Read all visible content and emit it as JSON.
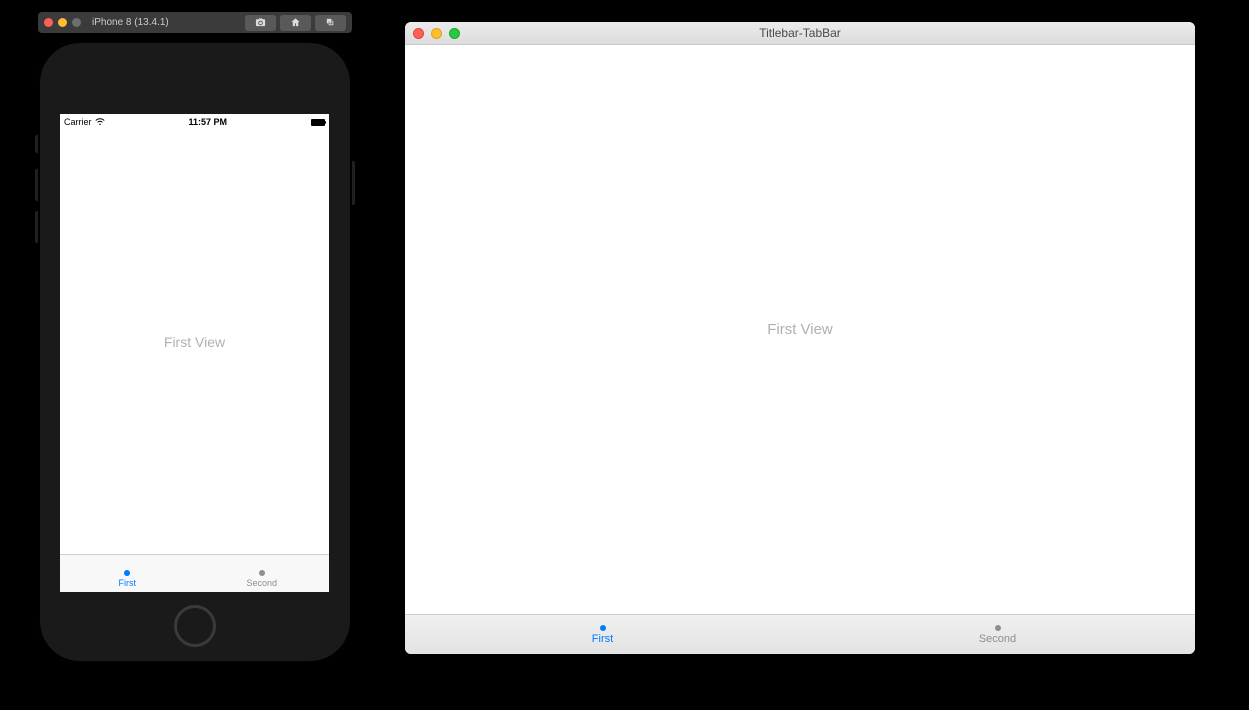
{
  "simulator": {
    "device_label": "iPhone 8 (13.4.1)",
    "buttons": {
      "screenshot": "camera-icon",
      "home": "home-icon",
      "rotate": "stack-icon"
    }
  },
  "iphone": {
    "status": {
      "carrier": "Carrier",
      "time": "11:57 PM"
    },
    "content_label": "First View",
    "tabs": [
      {
        "label": "First",
        "active": true
      },
      {
        "label": "Second",
        "active": false
      }
    ]
  },
  "mac": {
    "window_title": "Titlebar-TabBar",
    "content_label": "First View",
    "tabs": [
      {
        "label": "First",
        "active": true
      },
      {
        "label": "Second",
        "active": false
      }
    ]
  },
  "colors": {
    "ios_tint": "#007aff"
  }
}
